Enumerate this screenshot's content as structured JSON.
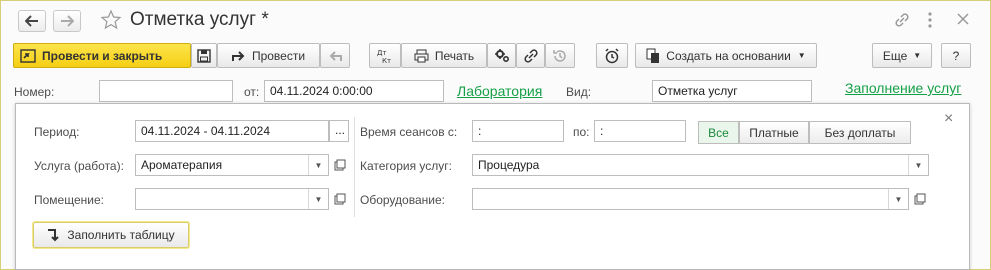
{
  "window": {
    "title": "Отметка услуг *"
  },
  "icons": {
    "back": "arrow-left-icon",
    "forward": "arrow-right-icon",
    "favorite": "star-icon",
    "link": "link-icon",
    "menu": "more-vertical-icon",
    "close": "close-icon"
  },
  "toolbar": {
    "post_close": "Провести и закрыть",
    "post": "Провести",
    "print": "Печать",
    "create_based": "Создать на основании",
    "more": "Еще",
    "help": "?"
  },
  "header": {
    "number_label": "Номер:",
    "number_value": "",
    "from_label": "от:",
    "date_value": "04.11.2024  0:00:00",
    "lab_link": "Лаборатория",
    "kind_label": "Вид:",
    "kind_value": "Отметка услуг",
    "fill_link": "Заполнение услуг"
  },
  "panel": {
    "period_label": "Период:",
    "period_value": "04.11.2024 - 04.11.2024",
    "period_btn": "...",
    "service_label": "Услуга (работа):",
    "service_value": "Ароматерапия",
    "room_label": "Помещение:",
    "room_value": "",
    "session_label": "Время сеансов с:",
    "session_from": " :",
    "po_label": "по:",
    "session_to": " :",
    "category_label": "Категория услуг:",
    "category_value": "Процедура",
    "equipment_label": "Оборудование:",
    "equipment_value": "",
    "filter_all": "Все",
    "filter_paid": "Платные",
    "filter_nopay": "Без доплаты",
    "fill_table": "Заполнить таблицу",
    "close": "×"
  },
  "colors": {
    "accent_yellow": "#f5cf14",
    "link_green": "#15a047"
  }
}
